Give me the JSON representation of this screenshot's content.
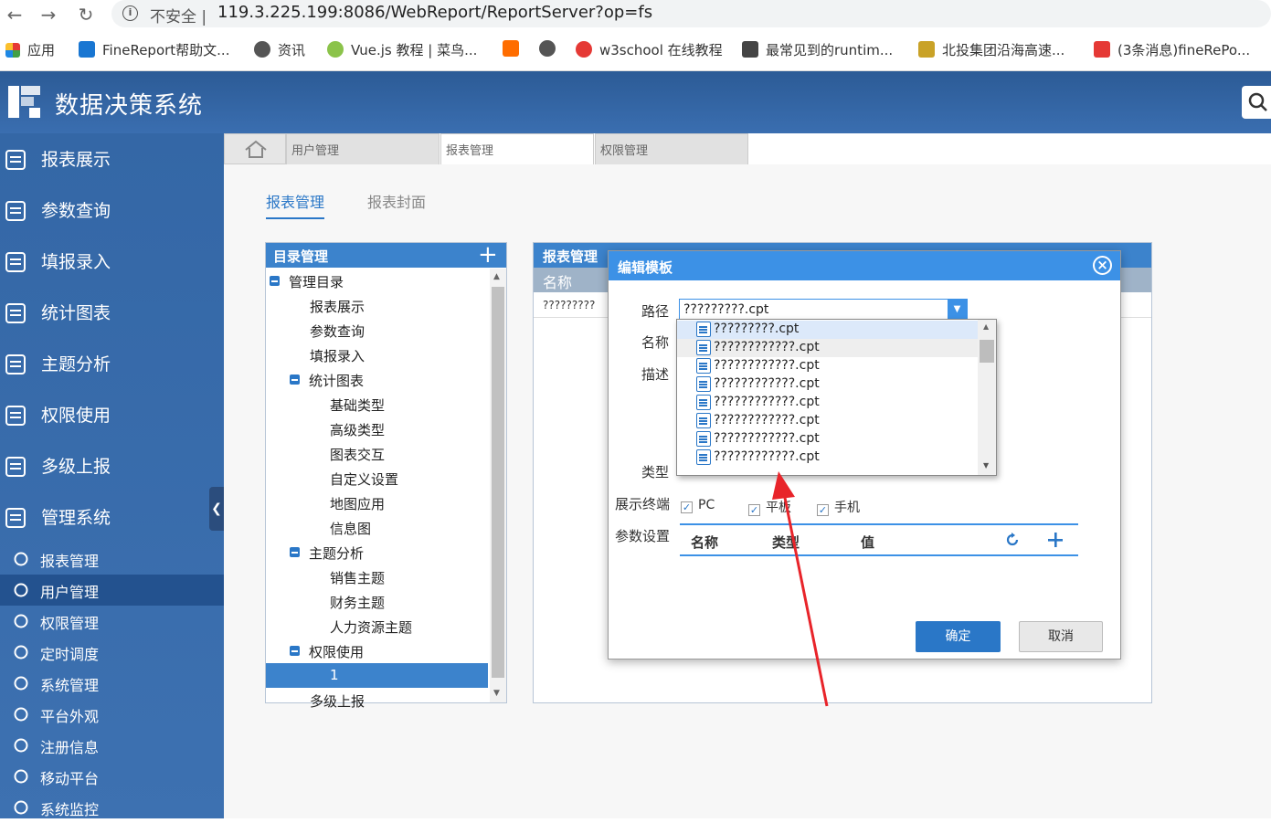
{
  "browser": {
    "insecure": "不安全 |",
    "url": "119.3.225.199:8086/WebReport/ReportServer?op=fs",
    "bookmarks": [
      "应用",
      "FineReport帮助文...",
      "资讯",
      "Vue.js 教程 | 菜鸟...",
      "w3school 在线教程",
      "最常见到的runtim...",
      "北投集团沿海高速...",
      "(3条消息)fineRePo..."
    ]
  },
  "app": {
    "title": "数据决策系统"
  },
  "sidebar": {
    "main": [
      {
        "label": "报表展示",
        "icon": "report-list-icon"
      },
      {
        "label": "参数查询",
        "icon": "magnifier-icon"
      },
      {
        "label": "填报录入",
        "icon": "pen-icon"
      },
      {
        "label": "统计图表",
        "icon": "chart-doc-icon"
      },
      {
        "label": "主题分析",
        "icon": "magic-wand-icon"
      },
      {
        "label": "权限使用",
        "icon": "permission-card-icon"
      },
      {
        "label": "多级上报",
        "icon": "bar-chart-icon"
      },
      {
        "label": "管理系统",
        "icon": "gear-icon"
      }
    ],
    "sub": [
      {
        "label": "报表管理",
        "icon": "report-manage-icon"
      },
      {
        "label": "用户管理",
        "icon": "user-icon"
      },
      {
        "label": "权限管理",
        "icon": "lock-icon"
      },
      {
        "label": "定时调度",
        "icon": "clock-icon"
      },
      {
        "label": "系统管理",
        "icon": "cog-icon"
      },
      {
        "label": "平台外观",
        "icon": "paint-roller-icon"
      },
      {
        "label": "注册信息",
        "icon": "register-icon"
      },
      {
        "label": "移动平台",
        "icon": "mobile-icon"
      },
      {
        "label": "系统监控",
        "icon": "binoculars-icon"
      }
    ],
    "active_sub": "用户管理"
  },
  "tabs": [
    "用户管理",
    "报表管理",
    "权限管理"
  ],
  "active_tab": "报表管理",
  "subtabs": [
    "报表管理",
    "报表封面"
  ],
  "dir_panel": {
    "title": "目录管理",
    "tree": [
      "管理目录",
      "报表展示",
      "参数查询",
      "填报录入",
      "统计图表",
      "基础类型",
      "高级类型",
      "图表交互",
      "自定义设置",
      "地图应用",
      "信息图",
      "主题分析",
      "销售主题",
      "财务主题",
      "人力资源主题",
      "权限使用",
      "1",
      "多级上报"
    ]
  },
  "rep_panel": {
    "title": "报表管理",
    "col_name": "名称",
    "row_value": "?????????"
  },
  "modal": {
    "title": "编辑模板",
    "labels": {
      "path": "路径",
      "name": "名称",
      "desc": "描述",
      "type": "类型",
      "terminal": "展示终端",
      "params": "参数设置"
    },
    "path_value": "?????????.cpt",
    "checks": [
      "PC",
      "平板",
      "手机"
    ],
    "param_headers": [
      "名称",
      "类型",
      "值"
    ],
    "ok": "确定",
    "cancel": "取消"
  },
  "dropdown": {
    "items": [
      "?????????.cpt",
      "????????????.cpt",
      "????????????.cpt",
      "????????????.cpt",
      "????????????.cpt",
      "????????????.cpt",
      "????????????.cpt",
      "????????????.cpt"
    ]
  },
  "colors": {
    "brand": "#2c5b96",
    "accent": "#3c91e6",
    "annotation": "#e8242a"
  }
}
